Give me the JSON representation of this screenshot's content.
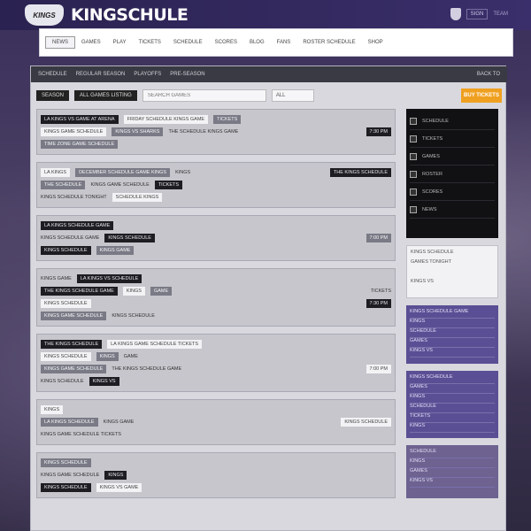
{
  "header": {
    "logo_text": "KINGS",
    "brand": "KINGSCHULE",
    "top_right": [
      "SIGN",
      "TEAM"
    ]
  },
  "nav": {
    "items": [
      "NEWS",
      "GAMES",
      "PLAY",
      "TICKETS",
      "SCHEDULE",
      "SCORES",
      "BLOG",
      "FANS",
      "ROSTER SCHEDULE",
      "SHOP"
    ],
    "active_index": 0
  },
  "crumbs": {
    "items": [
      "SCHEDULE",
      "REGULAR SEASON",
      "PLAYOFFS",
      "PRE-SEASON"
    ],
    "right": "BACK TO"
  },
  "filters": {
    "label1": "SEASON",
    "label2": "ALL GAMES LISTING",
    "search_placeholder": "SEARCH GAMES",
    "select_value": "ALL",
    "button": "BUY TICKETS"
  },
  "games": [
    {
      "rows": [
        [
          "LA KINGS VS GAME AT ARENA",
          "FRIDAY SCHEDULE KINGS GAME",
          "TICKETS",
          ""
        ],
        [
          "KINGS GAME SCHEDULE",
          "KINGS VS SHARKS",
          "THE SCHEDULE KINGS GAME",
          "7:30 PM"
        ],
        [
          "TIME ZONE GAME SCHEDULE",
          "",
          "",
          ""
        ]
      ]
    },
    {
      "rows": [
        [
          "LA KINGS",
          "DECEMBER SCHEDULE GAME KINGS",
          "KINGS",
          "THE KINGS SCHEDULE"
        ],
        [
          "THE SCHEDULE",
          "KINGS GAME SCHEDULE",
          "TICKETS",
          ""
        ],
        [
          "KINGS SCHEDULE TONIGHT",
          "",
          "SCHEDULE KINGS",
          ""
        ]
      ]
    },
    {
      "rows": [
        [
          "",
          "",
          "LA KINGS SCHEDULE GAME",
          ""
        ],
        [
          "KINGS SCHEDULE GAME",
          "KINGS SCHEDULE",
          "",
          "7:00 PM"
        ],
        [
          "KINGS SCHEDULE",
          "",
          "KINGS GAME",
          ""
        ]
      ]
    },
    {
      "rows": [
        [
          "KINGS GAME",
          "LA KINGS VS SCHEDULE",
          "",
          ""
        ],
        [
          "THE KINGS SCHEDULE GAME",
          "KINGS",
          "GAME",
          "TICKETS"
        ],
        [
          "KINGS SCHEDULE",
          "",
          "",
          "7:30 PM"
        ],
        [
          "KINGS GAME SCHEDULE",
          "KINGS SCHEDULE",
          "",
          ""
        ]
      ]
    },
    {
      "rows": [
        [
          "THE KINGS SCHEDULE",
          "LA KINGS GAME SCHEDULE TICKETS",
          "",
          ""
        ],
        [
          "KINGS SCHEDULE",
          "KINGS",
          "GAME",
          ""
        ],
        [
          "KINGS GAME SCHEDULE",
          "THE KINGS SCHEDULE GAME",
          "",
          "7:00 PM"
        ],
        [
          "KINGS SCHEDULE",
          "KINGS VS",
          "",
          ""
        ]
      ]
    },
    {
      "rows": [
        [
          "KINGS",
          "",
          "",
          ""
        ],
        [
          "LA KINGS SCHEDULE",
          "KINGS GAME",
          "",
          "KINGS SCHEDULE"
        ],
        [
          "KINGS GAME SCHEDULE TICKETS",
          "",
          "",
          ""
        ]
      ]
    },
    {
      "rows": [
        [
          "KINGS SCHEDULE",
          "",
          "",
          ""
        ],
        [
          "KINGS GAME SCHEDULE",
          "KINGS",
          "",
          ""
        ],
        [
          "KINGS SCHEDULE",
          "KINGS VS GAME",
          "",
          ""
        ]
      ]
    }
  ],
  "sidebar": {
    "dark_items": [
      "SCHEDULE",
      "TICKETS",
      "GAMES",
      "ROSTER",
      "SCORES",
      "NEWS"
    ],
    "white_lines": [
      "KINGS SCHEDULE",
      "GAMES TONIGHT",
      "",
      "KINGS VS"
    ],
    "purple_lines": [
      "KINGS SCHEDULE GAME",
      "KINGS",
      "SCHEDULE",
      "GAMES",
      "KINGS VS"
    ],
    "purple2_lines": [
      "KINGS SCHEDULE",
      "GAMES",
      "KINGS",
      "SCHEDULE",
      "TICKETS",
      "KINGS"
    ],
    "purple3_lines": [
      "SCHEDULE",
      "KINGS",
      "GAMES",
      "KINGS VS"
    ]
  },
  "colors": {
    "accent": "#f0a020",
    "brand_purple": "#3b2f6b",
    "side_purple": "#5a4f94"
  }
}
